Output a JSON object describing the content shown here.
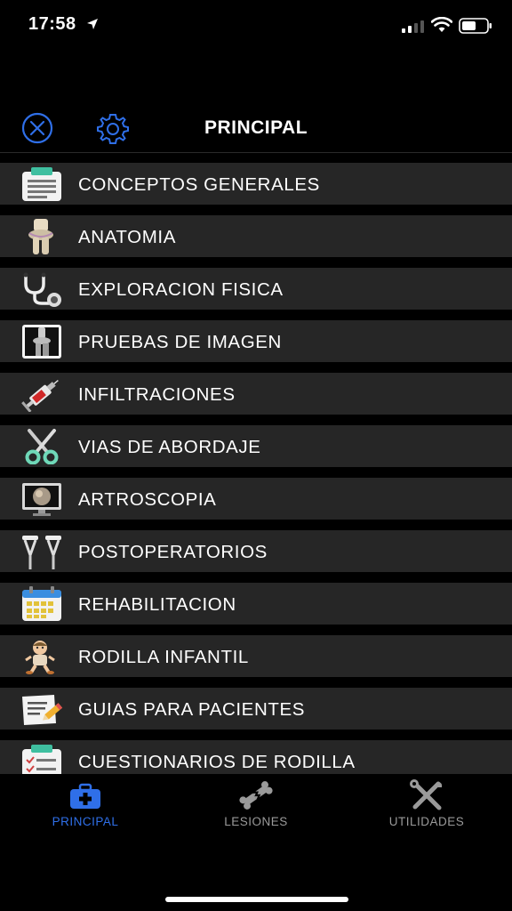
{
  "status_bar": {
    "time": "17:58"
  },
  "header": {
    "title": "PRINCIPAL"
  },
  "menu": [
    {
      "label": "CONCEPTOS GENERALES",
      "icon": "clipboard-icon"
    },
    {
      "label": "ANATOMIA",
      "icon": "knee-joint-icon"
    },
    {
      "label": "EXPLORACION FISICA",
      "icon": "stethoscope-icon"
    },
    {
      "label": "PRUEBAS DE IMAGEN",
      "icon": "xray-icon"
    },
    {
      "label": "INFILTRACIONES",
      "icon": "syringe-icon"
    },
    {
      "label": "VIAS DE ABORDAJE",
      "icon": "scissors-icon"
    },
    {
      "label": "ARTROSCOPIA",
      "icon": "monitor-icon"
    },
    {
      "label": "POSTOPERATORIOS",
      "icon": "crutches-icon"
    },
    {
      "label": "REHABILITACION",
      "icon": "calendar-icon"
    },
    {
      "label": "RODILLA INFANTIL",
      "icon": "child-icon"
    },
    {
      "label": "GUIAS PARA PACIENTES",
      "icon": "notepad-pencil-icon"
    },
    {
      "label": "CUESTIONARIOS DE RODILLA",
      "icon": "checklist-icon"
    }
  ],
  "tabs": [
    {
      "label": "PRINCIPAL",
      "icon": "medical-kit-icon",
      "active": true
    },
    {
      "label": "LESIONES",
      "icon": "broken-bone-icon",
      "active": false
    },
    {
      "label": "UTILIDADES",
      "icon": "tools-icon",
      "active": false
    }
  ],
  "colors": {
    "accent": "#2f6fe8",
    "row_background": "#262626",
    "inactive_tab": "#9a9a9a"
  }
}
